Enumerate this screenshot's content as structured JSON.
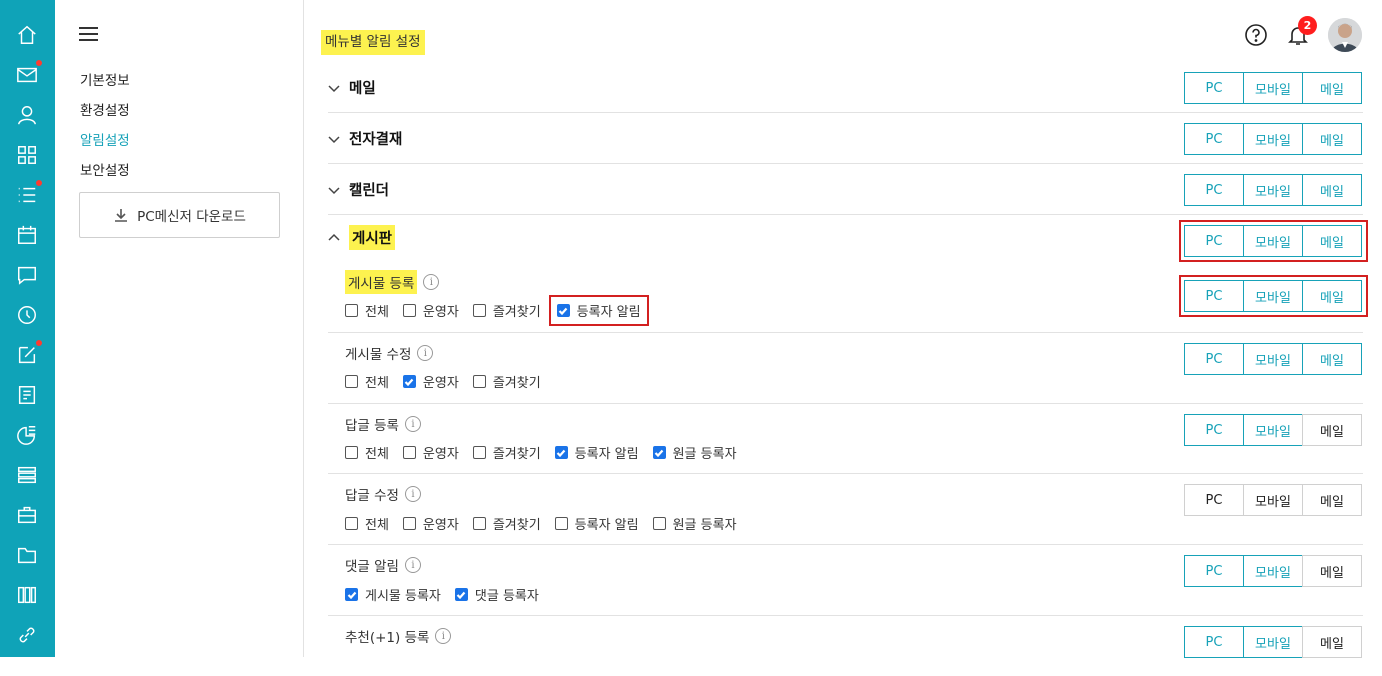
{
  "rail": {
    "icons": [
      {
        "name": "home-icon",
        "dot": false
      },
      {
        "name": "mail-icon",
        "dot": true
      },
      {
        "name": "contacts-icon",
        "dot": false
      },
      {
        "name": "apps-grid-icon",
        "dot": false
      },
      {
        "name": "task-list-icon",
        "dot": true
      },
      {
        "name": "calendar-icon",
        "dot": false
      },
      {
        "name": "chat-icon",
        "dot": false
      },
      {
        "name": "clock-icon",
        "dot": false
      },
      {
        "name": "edit-icon",
        "dot": true
      },
      {
        "name": "report-icon",
        "dot": false
      },
      {
        "name": "chart-icon",
        "dot": false
      },
      {
        "name": "list-stack-icon",
        "dot": false
      },
      {
        "name": "briefcase-icon",
        "dot": false
      },
      {
        "name": "folder-icon",
        "dot": false
      },
      {
        "name": "library-icon",
        "dot": false
      },
      {
        "name": "link-icon",
        "dot": false
      }
    ]
  },
  "sidebar": {
    "items": [
      {
        "label": "기본정보"
      },
      {
        "label": "환경설정"
      },
      {
        "label": "알림설정"
      },
      {
        "label": "보안설정"
      }
    ],
    "download_label": "PC메신저 다운로드"
  },
  "header": {
    "title": "메뉴별 알림 설정",
    "notification_count": "2"
  },
  "buttons": {
    "pc": "PC",
    "mobile": "모바일",
    "mail": "메일"
  },
  "sections": {
    "mail": "메일",
    "approval": "전자결재",
    "calendar": "캘린더",
    "board": "게시판"
  },
  "board_items": [
    {
      "title": "게시물 등록",
      "checks": [
        {
          "label": "전체",
          "checked": false
        },
        {
          "label": "운영자",
          "checked": false
        },
        {
          "label": "즐겨찾기",
          "checked": false
        },
        {
          "label": "등록자 알림",
          "checked": true
        }
      ]
    },
    {
      "title": "게시물 수정",
      "checks": [
        {
          "label": "전체",
          "checked": false
        },
        {
          "label": "운영자",
          "checked": true
        },
        {
          "label": "즐겨찾기",
          "checked": false
        }
      ]
    },
    {
      "title": "답글 등록",
      "checks": [
        {
          "label": "전체",
          "checked": false
        },
        {
          "label": "운영자",
          "checked": false
        },
        {
          "label": "즐겨찾기",
          "checked": false
        },
        {
          "label": "등록자 알림",
          "checked": true
        },
        {
          "label": "원글 등록자",
          "checked": true
        }
      ]
    },
    {
      "title": "답글 수정",
      "checks": [
        {
          "label": "전체",
          "checked": false
        },
        {
          "label": "운영자",
          "checked": false
        },
        {
          "label": "즐겨찾기",
          "checked": false
        },
        {
          "label": "등록자 알림",
          "checked": false
        },
        {
          "label": "원글 등록자",
          "checked": false
        }
      ]
    },
    {
      "title": "댓글 알림",
      "checks": [
        {
          "label": "게시물 등록자",
          "checked": true
        },
        {
          "label": "댓글 등록자",
          "checked": true
        }
      ]
    },
    {
      "title": "추천(+1) 등록",
      "checks": []
    }
  ],
  "colors": {
    "rail": "#0fa3b8",
    "accent": "#17a2b8",
    "highlight": "#fdf24f",
    "alert": "#ff1e1e",
    "focus_box": "#d32020"
  }
}
